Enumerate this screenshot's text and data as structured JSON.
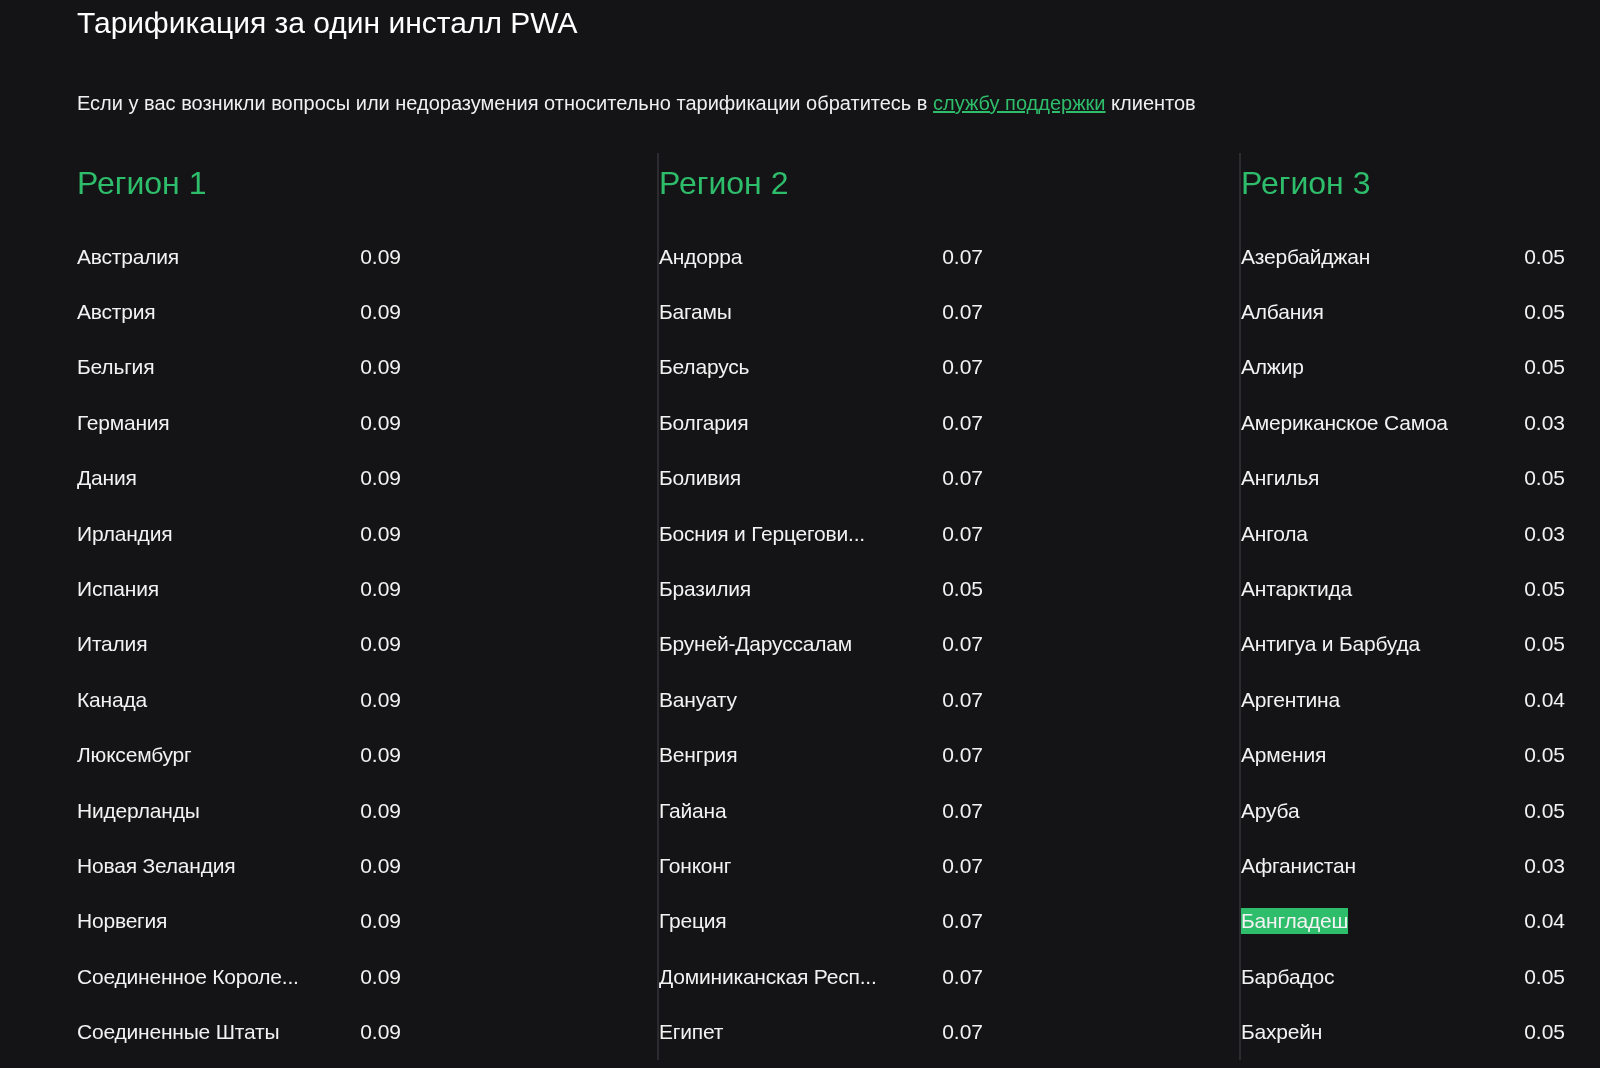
{
  "title": "Тарификация за один инсталл PWA",
  "notice": {
    "before": "Если у вас возникли вопросы или недоразумения относительно тарификации обратитесь в",
    "link": "службу поддержки",
    "after": "клиентов"
  },
  "regions": [
    {
      "title": "Регион 1",
      "rows": [
        {
          "country": "Австралия",
          "price": "0.09",
          "highlighted": false
        },
        {
          "country": "Австрия",
          "price": "0.09",
          "highlighted": false
        },
        {
          "country": "Бельгия",
          "price": "0.09",
          "highlighted": false
        },
        {
          "country": "Германия",
          "price": "0.09",
          "highlighted": false
        },
        {
          "country": "Дания",
          "price": "0.09",
          "highlighted": false
        },
        {
          "country": "Ирландия",
          "price": "0.09",
          "highlighted": false
        },
        {
          "country": "Испания",
          "price": "0.09",
          "highlighted": false
        },
        {
          "country": "Италия",
          "price": "0.09",
          "highlighted": false
        },
        {
          "country": "Канада",
          "price": "0.09",
          "highlighted": false
        },
        {
          "country": "Люксембург",
          "price": "0.09",
          "highlighted": false
        },
        {
          "country": "Нидерланды",
          "price": "0.09",
          "highlighted": false
        },
        {
          "country": "Новая Зеландия",
          "price": "0.09",
          "highlighted": false
        },
        {
          "country": "Норвегия",
          "price": "0.09",
          "highlighted": false
        },
        {
          "country": "Соединенное Короле...",
          "price": "0.09",
          "highlighted": false
        },
        {
          "country": "Соединенные Штаты",
          "price": "0.09",
          "highlighted": false
        }
      ]
    },
    {
      "title": "Регион 2",
      "rows": [
        {
          "country": "Андорра",
          "price": "0.07",
          "highlighted": false
        },
        {
          "country": "Багамы",
          "price": "0.07",
          "highlighted": false
        },
        {
          "country": "Беларусь",
          "price": "0.07",
          "highlighted": false
        },
        {
          "country": "Болгария",
          "price": "0.07",
          "highlighted": false
        },
        {
          "country": "Боливия",
          "price": "0.07",
          "highlighted": false
        },
        {
          "country": "Босния и Герцегови...",
          "price": "0.07",
          "highlighted": false
        },
        {
          "country": "Бразилия",
          "price": "0.05",
          "highlighted": false
        },
        {
          "country": "Бруней-Даруссалам",
          "price": "0.07",
          "highlighted": false
        },
        {
          "country": "Вануату",
          "price": "0.07",
          "highlighted": false
        },
        {
          "country": "Венгрия",
          "price": "0.07",
          "highlighted": false
        },
        {
          "country": "Гайана",
          "price": "0.07",
          "highlighted": false
        },
        {
          "country": "Гонконг",
          "price": "0.07",
          "highlighted": false
        },
        {
          "country": "Греция",
          "price": "0.07",
          "highlighted": false
        },
        {
          "country": "Доминиканская Респ...",
          "price": "0.07",
          "highlighted": false
        },
        {
          "country": "Египет",
          "price": "0.07",
          "highlighted": false
        }
      ]
    },
    {
      "title": "Регион 3",
      "rows": [
        {
          "country": "Азербайджан",
          "price": "0.05",
          "highlighted": false
        },
        {
          "country": "Албания",
          "price": "0.05",
          "highlighted": false
        },
        {
          "country": "Алжир",
          "price": "0.05",
          "highlighted": false
        },
        {
          "country": "Американское Самоа",
          "price": "0.03",
          "highlighted": false
        },
        {
          "country": "Ангилья",
          "price": "0.05",
          "highlighted": false
        },
        {
          "country": "Ангола",
          "price": "0.03",
          "highlighted": false
        },
        {
          "country": "Антарктида",
          "price": "0.05",
          "highlighted": false
        },
        {
          "country": "Антигуа и Барбуда",
          "price": "0.05",
          "highlighted": false
        },
        {
          "country": "Аргентина",
          "price": "0.04",
          "highlighted": false
        },
        {
          "country": "Армения",
          "price": "0.05",
          "highlighted": false
        },
        {
          "country": "Аруба",
          "price": "0.05",
          "highlighted": false
        },
        {
          "country": "Афганистан",
          "price": "0.03",
          "highlighted": false
        },
        {
          "country": "Бангладеш",
          "price": "0.04",
          "highlighted": true
        },
        {
          "country": "Барбадос",
          "price": "0.05",
          "highlighted": false
        },
        {
          "country": "Бахрейн",
          "price": "0.05",
          "highlighted": false
        }
      ]
    }
  ]
}
